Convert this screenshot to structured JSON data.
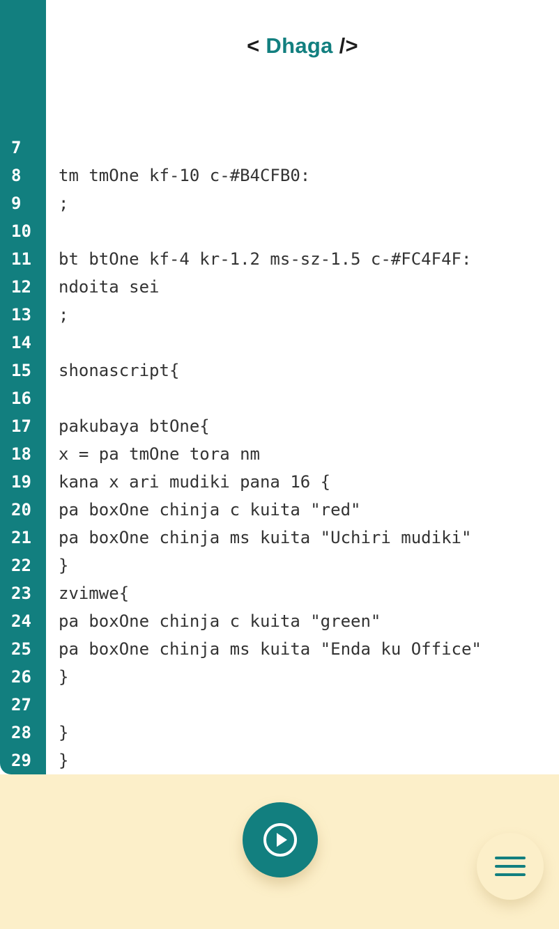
{
  "header": {
    "title_open": "< ",
    "title_name": "Dhaga",
    "title_close": " />"
  },
  "editor": {
    "lines": [
      {
        "n": "7",
        "text": ""
      },
      {
        "n": "8",
        "text": "tm tmOne kf-10 c-#B4CFB0:"
      },
      {
        "n": "9",
        "text": ";"
      },
      {
        "n": "10",
        "text": ""
      },
      {
        "n": "11",
        "text": "bt btOne kf-4 kr-1.2 ms-sz-1.5 c-#FC4F4F:"
      },
      {
        "n": "12",
        "text": "ndoita sei"
      },
      {
        "n": "13",
        "text": ";"
      },
      {
        "n": "14",
        "text": ""
      },
      {
        "n": "15",
        "text": "shonascript{"
      },
      {
        "n": "16",
        "text": ""
      },
      {
        "n": "17",
        "text": "pakubaya btOne{"
      },
      {
        "n": "18",
        "text": "x = pa tmOne tora nm"
      },
      {
        "n": "19",
        "text": "kana x ari mudiki pana 16 {"
      },
      {
        "n": "20",
        "text": "pa boxOne chinja c kuita \"red\""
      },
      {
        "n": "21",
        "text": "pa boxOne chinja ms kuita \"Uchiri mudiki\""
      },
      {
        "n": "22",
        "text": "}"
      },
      {
        "n": "23",
        "text": "zvimwe{"
      },
      {
        "n": "24",
        "text": "pa boxOne chinja c kuita \"green\""
      },
      {
        "n": "25",
        "text": "pa boxOne chinja ms kuita \"Enda ku Office\""
      },
      {
        "n": "26",
        "text": "}"
      },
      {
        "n": "27",
        "text": ""
      },
      {
        "n": "28",
        "text": "}"
      },
      {
        "n": "29",
        "text": "}"
      }
    ]
  },
  "toolbar": {
    "run_icon": "play-circle-icon",
    "menu_icon": "hamburger-menu-icon"
  },
  "colors": {
    "accent": "#127f7f",
    "bottom_bar": "#fcefc9",
    "code_text": "#333333"
  }
}
